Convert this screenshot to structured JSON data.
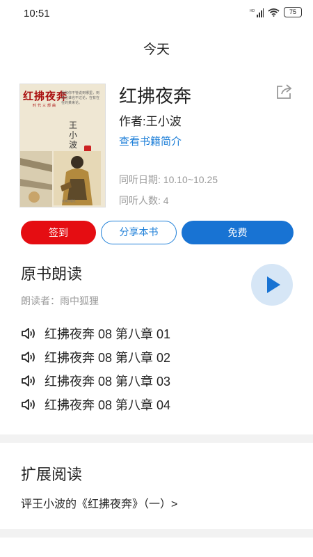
{
  "status": {
    "time": "10:51",
    "battery": "75",
    "network": "HD"
  },
  "nav": {
    "title": "今天"
  },
  "book": {
    "cover": {
      "title": "红拂夜奔",
      "series": "时代三部曲",
      "author": "王小波",
      "blurb": "我和你不管说到哪里，到死也谁也不过论，在有在在的某来论。",
      "publisher": "花城出版社"
    },
    "title": "红拂夜奔",
    "author": "作者:王小波",
    "intro_link": "查看书籍简介",
    "dates": "同听日期: 10.10~10.25",
    "listeners": "同听人数: 4"
  },
  "actions": {
    "checkin": "签到",
    "share": "分享本书",
    "free": "免费"
  },
  "reading": {
    "title": "原书朗读",
    "reader": "朗读者：雨中狐狸",
    "chapters": [
      {
        "label": "红拂夜奔 08 第八章 01"
      },
      {
        "label": "红拂夜奔 08 第八章 02"
      },
      {
        "label": "红拂夜奔 08 第八章 03"
      },
      {
        "label": "红拂夜奔 08 第八章 04"
      }
    ]
  },
  "extended": {
    "title": "扩展阅读",
    "link": "评王小波的《红拂夜奔》（一）>"
  },
  "colors": {
    "accent_blue": "#1873d3",
    "red": "#e50d12",
    "play_bg": "#d6e6f6"
  }
}
